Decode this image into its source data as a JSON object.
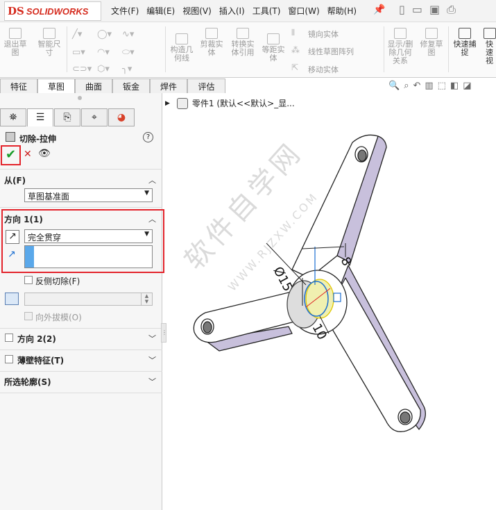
{
  "app": {
    "logo_mark": "DS",
    "logo_text": "SOLIDWORKS"
  },
  "menu": [
    "文件(F)",
    "编辑(E)",
    "视图(V)",
    "插入(I)",
    "工具(T)",
    "窗口(W)",
    "帮助(H)"
  ],
  "ribbon": {
    "exit_sketch": "退出草图",
    "smart_dim": "智能尺寸",
    "construction": "构造几何线",
    "trim": "剪裁实体",
    "convert": "转换实体引用",
    "offset": "等距实体",
    "mirror": "镜向实体",
    "linear_pattern": "线性草图阵列",
    "move": "移动实体",
    "show_relations": "显示/删除几何关系",
    "repair": "修复草图",
    "quick_snap": "快速捕捉",
    "quick_view": "快速视"
  },
  "cm_tabs": [
    "特征",
    "草图",
    "曲面",
    "钣金",
    "焊件",
    "评估"
  ],
  "tree": {
    "part_label": "零件1  (默认<<默认>_显..."
  },
  "pm": {
    "title": "切除-拉伸",
    "help": "?",
    "from_header": "从(F)",
    "from_value": "草图基准面",
    "dir1_header": "方向 1(1)",
    "dir1_value": "完全贯穿",
    "flip_side": "反侧切除(F)",
    "draft_outward": "向外拔模(O)",
    "dir2_header": "方向 2(2)",
    "thin_header": "薄壁特征(T)",
    "contours_header": "所选轮廓(S)"
  },
  "model": {
    "dim_diameter": "Ø15",
    "dim_8": "8",
    "dim_10": "10"
  },
  "watermark": {
    "main": "软件自学网",
    "url": "WWW.RJZXW.COM"
  }
}
